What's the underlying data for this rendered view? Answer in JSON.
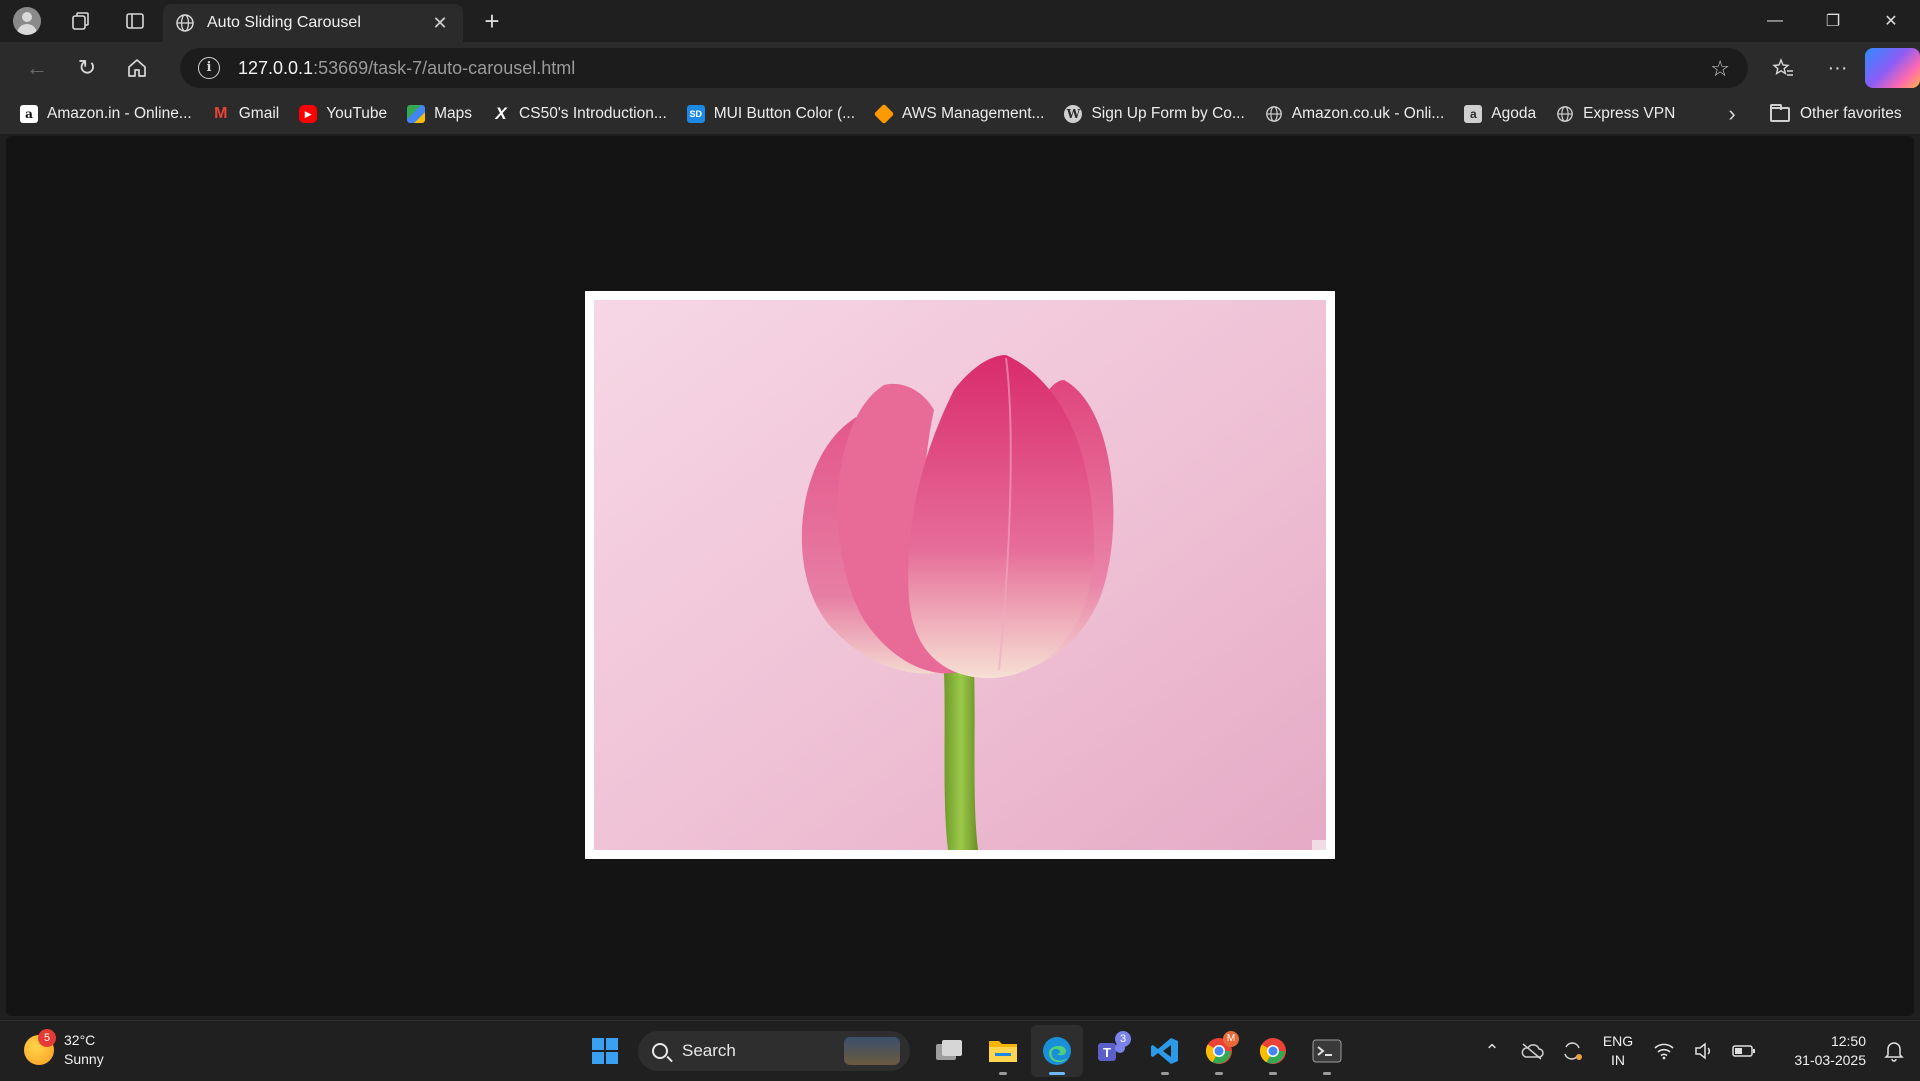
{
  "browser": {
    "tab": {
      "title": "Auto Sliding Carousel"
    },
    "address": {
      "host": "127.0.0.1",
      "rest": ":53669/task-7/auto-carousel.html"
    },
    "bookmarks": [
      {
        "label": "Amazon.in - Online...",
        "icon": "amazon-icon",
        "color": "#ffffff"
      },
      {
        "label": "Gmail",
        "icon": "gmail-icon",
        "color": "#ea4335"
      },
      {
        "label": "YouTube",
        "icon": "youtube-icon",
        "color": "#ff0000"
      },
      {
        "label": "Maps",
        "icon": "maps-icon",
        "color": "#34a853"
      },
      {
        "label": "CS50's Introduction...",
        "icon": "x-icon",
        "color": "#ffffff"
      },
      {
        "label": "MUI Button Color (...",
        "icon": "sd-icon",
        "color": "#1e88e5"
      },
      {
        "label": "AWS Management...",
        "icon": "aws-icon",
        "color": "#ff9900"
      },
      {
        "label": "Sign Up Form by Co...",
        "icon": "wordpress-icon",
        "color": "#cfcfcf"
      },
      {
        "label": "Amazon.co.uk - Onli...",
        "icon": "globe-icon",
        "color": "#cfcfcf"
      },
      {
        "label": "Agoda",
        "icon": "agoda-icon",
        "color": "#cfcfcf"
      },
      {
        "label": "Express VPN",
        "icon": "globe-icon",
        "color": "#cfcfcf"
      }
    ],
    "other_favorites": "Other favorites"
  },
  "page": {
    "carousel": {
      "slide_subject": "pink-tulip-image",
      "background": "#141414",
      "frame": "#ffffff"
    }
  },
  "taskbar": {
    "weather": {
      "temp": "32°C",
      "condition": "Sunny",
      "badge": "5"
    },
    "search_label": "Search",
    "teams_badge": "3",
    "chrome_badge": "M",
    "lang": {
      "line1": "ENG",
      "line2": "IN"
    },
    "clock": {
      "time": "12:50",
      "date": "31-03-2025"
    }
  }
}
